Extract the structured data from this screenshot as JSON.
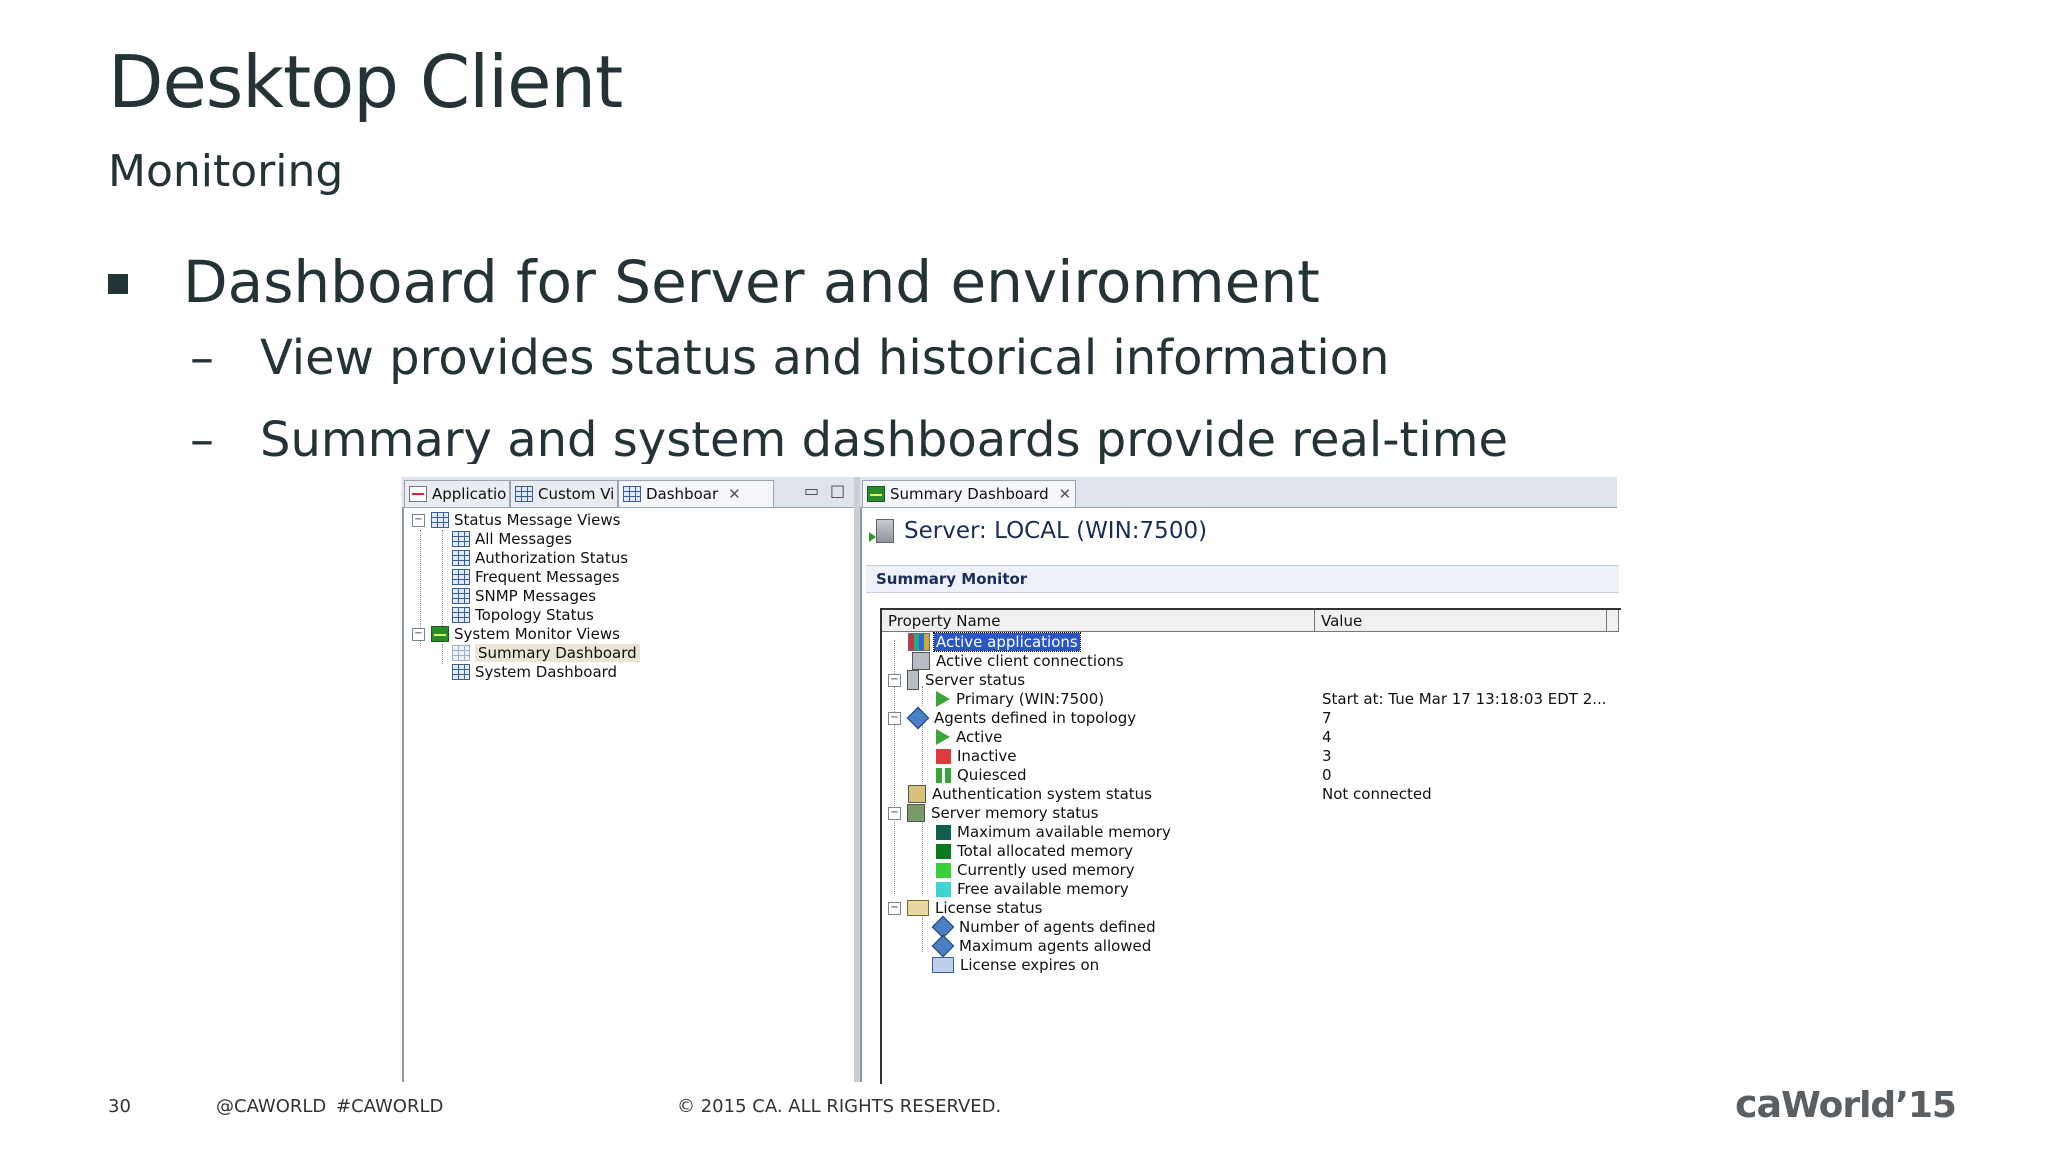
{
  "slide": {
    "title": "Desktop Client",
    "subtitle": "Monitoring",
    "bullet1": "Dashboard for Server and environment",
    "sub1": "View provides status and historical information",
    "sub2": "Summary and system dashboards provide real-time",
    "dash": "–"
  },
  "left_tabs": [
    {
      "label": "Applicatio"
    },
    {
      "label": "Custom Vi"
    },
    {
      "label": "Dashboar"
    }
  ],
  "right_tab": {
    "label": "Summary Dashboard"
  },
  "close_glyph": "✕",
  "tree": {
    "status_group": "Status Message Views",
    "status_items": [
      "All Messages",
      "Authorization Status",
      "Frequent Messages",
      "SNMP Messages",
      "Topology Status"
    ],
    "monitor_group": "System Monitor Views",
    "monitor_items": [
      "Summary Dashboard",
      "System Dashboard"
    ]
  },
  "dashboard": {
    "server_title": "Server: LOCAL (WIN:7500)",
    "section": "Summary Monitor",
    "col_property": "Property Name",
    "col_value": "Value",
    "rows": [
      {
        "label": "Active applications",
        "value": ""
      },
      {
        "label": "Active client connections",
        "value": ""
      },
      {
        "label": "Server status",
        "value": ""
      },
      {
        "label": "Primary (WIN:7500)",
        "value": "Start at: Tue Mar 17 13:18:03 EDT 2..."
      },
      {
        "label": "Agents defined in topology",
        "value": "7"
      },
      {
        "label": "Active",
        "value": "4"
      },
      {
        "label": "Inactive",
        "value": "3"
      },
      {
        "label": "Quiesced",
        "value": "0"
      },
      {
        "label": "Authentication system status",
        "value": "Not connected"
      },
      {
        "label": "Server memory status",
        "value": ""
      },
      {
        "label": "Maximum available memory",
        "value": ""
      },
      {
        "label": "Total allocated memory",
        "value": ""
      },
      {
        "label": "Currently used memory",
        "value": ""
      },
      {
        "label": "Free available memory",
        "value": ""
      },
      {
        "label": "License status",
        "value": ""
      },
      {
        "label": "Number of agents defined",
        "value": ""
      },
      {
        "label": "Maximum agents allowed",
        "value": ""
      },
      {
        "label": "License expires on",
        "value": ""
      }
    ]
  },
  "colors": {
    "mem_max": "#0f5e4e",
    "mem_total": "#0a7a1e",
    "mem_used": "#39d139",
    "mem_free": "#3fd4d0",
    "inactive": "#e03b3b",
    "quiesced": "#3aa63a"
  },
  "footer": {
    "page": "30",
    "social1": "@CAWORLD",
    "social2": "#CAWORLD",
    "copyright": "© 2015 CA. ALL RIGHTS RESERVED.",
    "logo_ca": "ca",
    "logo_world": "World",
    "logo_year": "’15"
  }
}
